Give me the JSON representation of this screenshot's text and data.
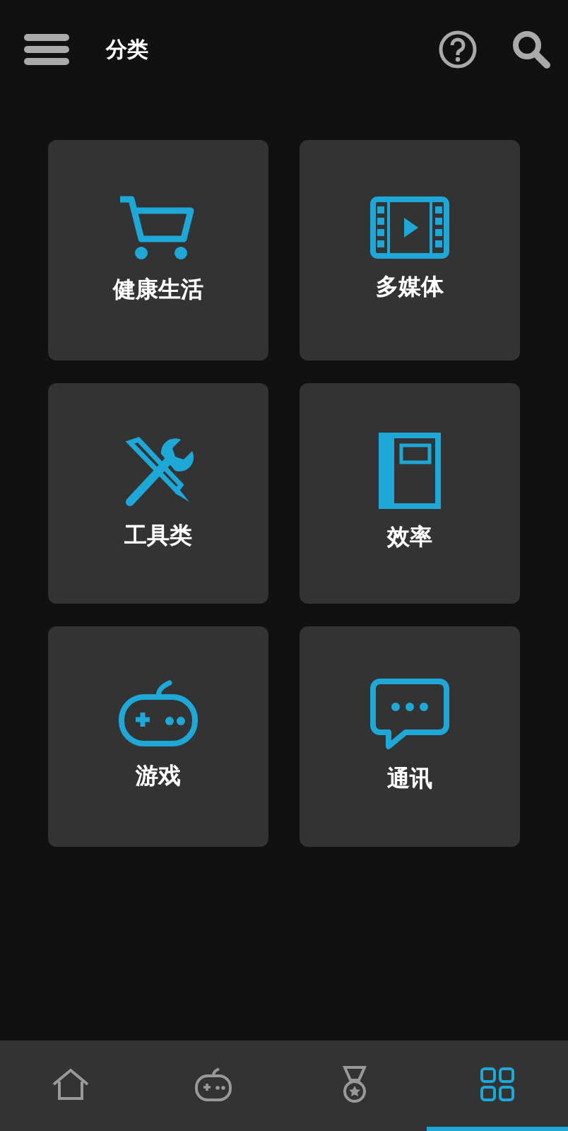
{
  "header": {
    "title": "分类"
  },
  "categories": [
    {
      "label": "健康生活",
      "kind": "cart"
    },
    {
      "label": "多媒体",
      "kind": "film"
    },
    {
      "label": "工具类",
      "kind": "tools"
    },
    {
      "label": "效率",
      "kind": "book"
    },
    {
      "label": "游戏",
      "kind": "gamepad"
    },
    {
      "label": "通讯",
      "kind": "chat"
    }
  ],
  "bottom_nav": [
    {
      "kind": "home",
      "selected": false
    },
    {
      "kind": "gamepad",
      "selected": false
    },
    {
      "kind": "medal",
      "selected": false
    },
    {
      "kind": "grid",
      "selected": true
    }
  ]
}
